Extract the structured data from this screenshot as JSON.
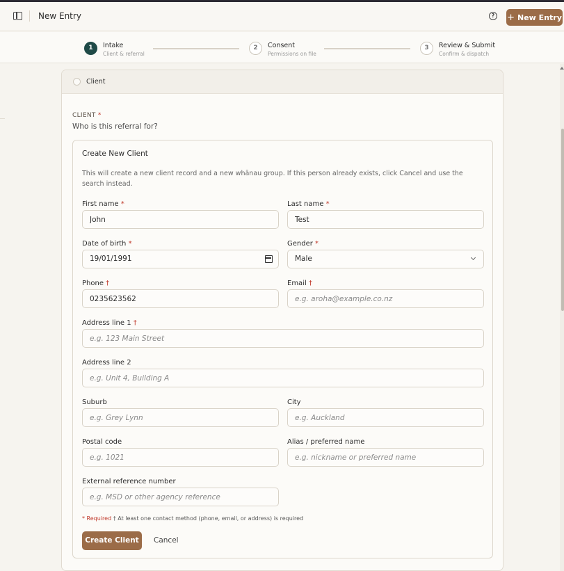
{
  "header": {
    "title": "New Entry",
    "new_entry_label": "New Entry"
  },
  "stepper": {
    "steps": [
      {
        "number": "1",
        "label": "Intake",
        "sub": "Client & referral"
      },
      {
        "number": "2",
        "label": "Consent",
        "sub": "Permissions on file"
      },
      {
        "number": "3",
        "label": "Review & Submit",
        "sub": "Confirm & dispatch"
      }
    ]
  },
  "client_card": {
    "head_label": "Client",
    "section_label": "CLIENT",
    "section_required_mark": "*",
    "question": "Who is this referral for?"
  },
  "create_panel": {
    "title": "Create New Client",
    "description": "This will create a new client record and a new whānau group. If this person already exists, click Cancel and use the search instead.",
    "fields": {
      "first_name": {
        "label": "First name",
        "mark": "*",
        "value": "John"
      },
      "last_name": {
        "label": "Last name",
        "mark": "*",
        "value": "Test"
      },
      "dob": {
        "label": "Date of birth",
        "mark": "*",
        "value": "19/01/1991"
      },
      "gender": {
        "label": "Gender",
        "mark": "*",
        "value": "Male"
      },
      "phone": {
        "label": "Phone",
        "mark": "†",
        "value": "0235623562"
      },
      "email": {
        "label": "Email",
        "mark": "†",
        "placeholder": "e.g. aroha@example.co.nz"
      },
      "address1": {
        "label": "Address line 1",
        "mark": "†",
        "placeholder": "e.g. 123 Main Street"
      },
      "address2": {
        "label": "Address line 2",
        "placeholder": "e.g. Unit 4, Building A"
      },
      "suburb": {
        "label": "Suburb",
        "placeholder": "e.g. Grey Lynn"
      },
      "city": {
        "label": "City",
        "placeholder": "e.g. Auckland"
      },
      "postal": {
        "label": "Postal code",
        "placeholder": "e.g. 1021"
      },
      "alias": {
        "label": "Alias / preferred name",
        "placeholder": "e.g. nickname or preferred name"
      },
      "extref": {
        "label": "External reference number",
        "placeholder": "e.g. MSD or other agency reference"
      }
    },
    "footnote_required": "* Required",
    "footnote_contact": "† At least one contact method (phone, email, or address) is required",
    "create_label": "Create Client",
    "cancel_label": "Cancel"
  },
  "colors": {
    "accent": "#9b6c48",
    "active_step": "#1f4a47",
    "required": "#c0392b"
  }
}
